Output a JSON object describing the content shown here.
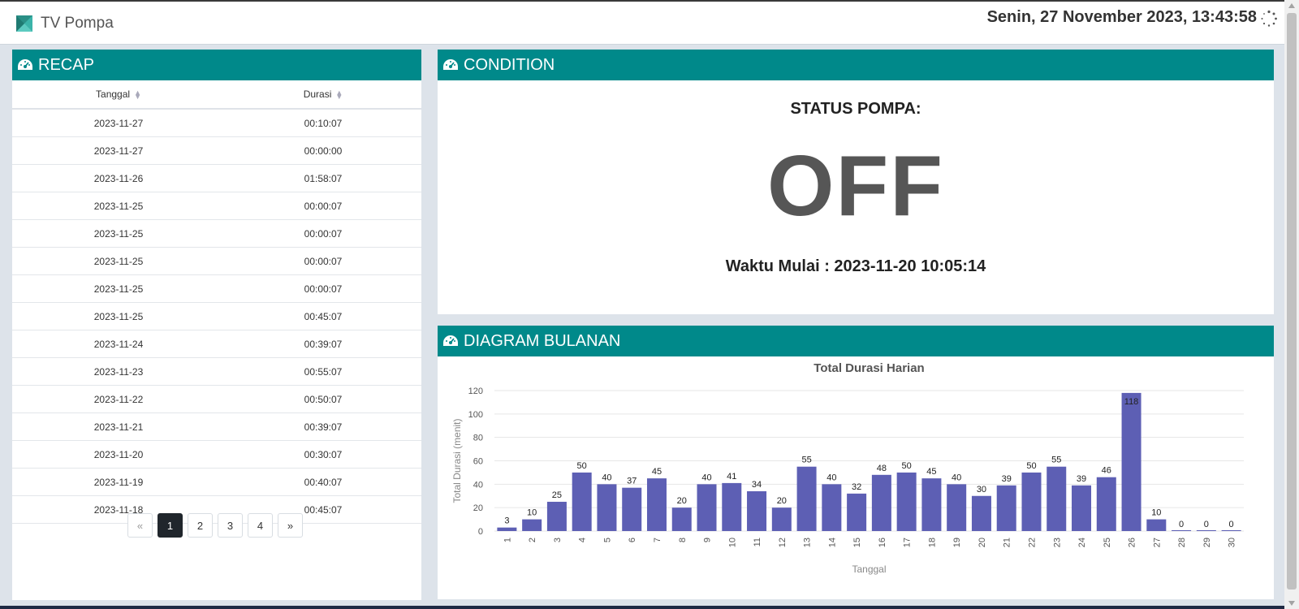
{
  "app": {
    "title": "TV Pompa",
    "datetime": "Senin, 27 November 2023, 13:43:58"
  },
  "colors": {
    "header": "#00898a",
    "bar": "#5d5fb4",
    "status_text": "#565656"
  },
  "recap": {
    "title": "RECAP",
    "icon": "dashboard-icon",
    "columns": [
      "Tanggal",
      "Durasi"
    ],
    "rows": [
      [
        "2023-11-27",
        "00:10:07"
      ],
      [
        "2023-11-27",
        "00:00:00"
      ],
      [
        "2023-11-26",
        "01:58:07"
      ],
      [
        "2023-11-25",
        "00:00:07"
      ],
      [
        "2023-11-25",
        "00:00:07"
      ],
      [
        "2023-11-25",
        "00:00:07"
      ],
      [
        "2023-11-25",
        "00:00:07"
      ],
      [
        "2023-11-25",
        "00:45:07"
      ],
      [
        "2023-11-24",
        "00:39:07"
      ],
      [
        "2023-11-23",
        "00:55:07"
      ],
      [
        "2023-11-22",
        "00:50:07"
      ],
      [
        "2023-11-21",
        "00:39:07"
      ],
      [
        "2023-11-20",
        "00:30:07"
      ],
      [
        "2023-11-19",
        "00:40:07"
      ],
      [
        "2023-11-18",
        "00:45:07"
      ]
    ],
    "pagination": {
      "prev": "«",
      "next": "»",
      "pages": [
        "1",
        "2",
        "3",
        "4"
      ],
      "active": "1"
    }
  },
  "condition": {
    "title": "CONDITION",
    "status_label": "STATUS POMPA:",
    "status_value": "OFF",
    "start_time": "Waktu Mulai : 2023-11-20 10:05:14"
  },
  "diagram": {
    "title": "DIAGRAM BULANAN"
  },
  "chart_data": {
    "type": "bar",
    "title": "Total Durasi Harian",
    "xlabel": "Tanggal",
    "ylabel": "Total Durasi (menit)",
    "ylim": [
      0,
      120
    ],
    "yticks": [
      0,
      20,
      40,
      60,
      80,
      100,
      120
    ],
    "grid": true,
    "categories": [
      "1",
      "2",
      "3",
      "4",
      "5",
      "6",
      "7",
      "8",
      "9",
      "10",
      "11",
      "12",
      "13",
      "14",
      "15",
      "16",
      "17",
      "18",
      "19",
      "20",
      "21",
      "22",
      "23",
      "24",
      "25",
      "26",
      "27",
      "28",
      "29",
      "30"
    ],
    "values": [
      3,
      10,
      25,
      50,
      40,
      37,
      45,
      20,
      40,
      41,
      34,
      20,
      55,
      40,
      32,
      48,
      50,
      45,
      40,
      30,
      39,
      50,
      55,
      39,
      46,
      118,
      10,
      0,
      0,
      0
    ]
  }
}
